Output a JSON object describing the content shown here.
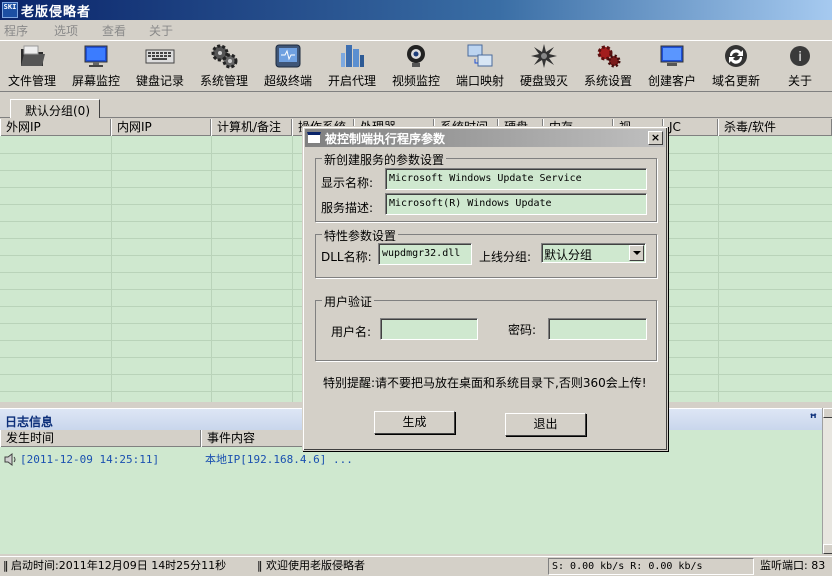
{
  "window": {
    "title": "老版侵略者",
    "logo_text": "SKI"
  },
  "menu": [
    "程序",
    "选项",
    "查看",
    "关于"
  ],
  "toolbar": [
    {
      "label": "文件管理",
      "icon": "folder-icon"
    },
    {
      "label": "屏幕监控",
      "icon": "monitor-icon"
    },
    {
      "label": "键盘记录",
      "icon": "keyboard-icon"
    },
    {
      "label": "系统管理",
      "icon": "gears-icon"
    },
    {
      "label": "超级终端",
      "icon": "terminal-icon"
    },
    {
      "label": "开启代理",
      "icon": "proxy-server-icon"
    },
    {
      "label": "视频监控",
      "icon": "webcam-icon"
    },
    {
      "label": "端口映射",
      "icon": "port-mapping-icon"
    },
    {
      "label": "硬盘毁灭",
      "icon": "disk-destroy-icon"
    },
    {
      "label": "系统设置",
      "icon": "settings-icon"
    },
    {
      "label": "创建客户",
      "icon": "create-client-icon"
    },
    {
      "label": "域名更新",
      "icon": "refresh-icon"
    },
    {
      "label": "关于",
      "icon": "about-icon"
    }
  ],
  "group_tab": {
    "label": "默认分组(0)"
  },
  "client_table": {
    "columns": [
      "外网IP",
      "内网IP",
      "计算机/备注",
      "操作系统",
      "处理器",
      "系统时间",
      "硬盘",
      "内存",
      "视",
      "JC",
      "杀毒/软件"
    ]
  },
  "log": {
    "title": "日志信息",
    "pin": "ꟸ",
    "columns": [
      "发生时间",
      "事件内容"
    ],
    "rows": [
      {
        "time": "[2011-12-09 14:25:11]",
        "event": "本地IP[192.168.4.6] ..."
      }
    ]
  },
  "status": {
    "start_time": "启动时间:2011年12月09日 14时25分11秒",
    "welcome": "欢迎使用老版侵略者",
    "speed": "S: 0.00 kb/s R: 0.00 kb/s",
    "port": "监听端口: 83"
  },
  "dialog": {
    "title": "被控制端执行程序参数",
    "close": "×",
    "service_group": {
      "legend": "新创建服务的参数设置",
      "display_name_label": "显示名称:",
      "display_name_value": "Microsoft Windows Update Service",
      "description_label": "服务描述:",
      "description_value": "Microsoft(R) Windows Update"
    },
    "feature_group": {
      "legend": "特性参数设置",
      "dll_label": "DLL名称:",
      "dll_value": "wupdmgr32.dll",
      "group_label": "上线分组:",
      "group_value": "默认分组"
    },
    "auth_group": {
      "legend": "用户验证",
      "user_label": "用户名:",
      "user_value": "",
      "password_label": "密码:",
      "password_value": ""
    },
    "warning": "特别提醒:请不要把马放在桌面和系统目录下,否则360会上传!",
    "generate_button": "生成",
    "exit_button": "退出"
  }
}
